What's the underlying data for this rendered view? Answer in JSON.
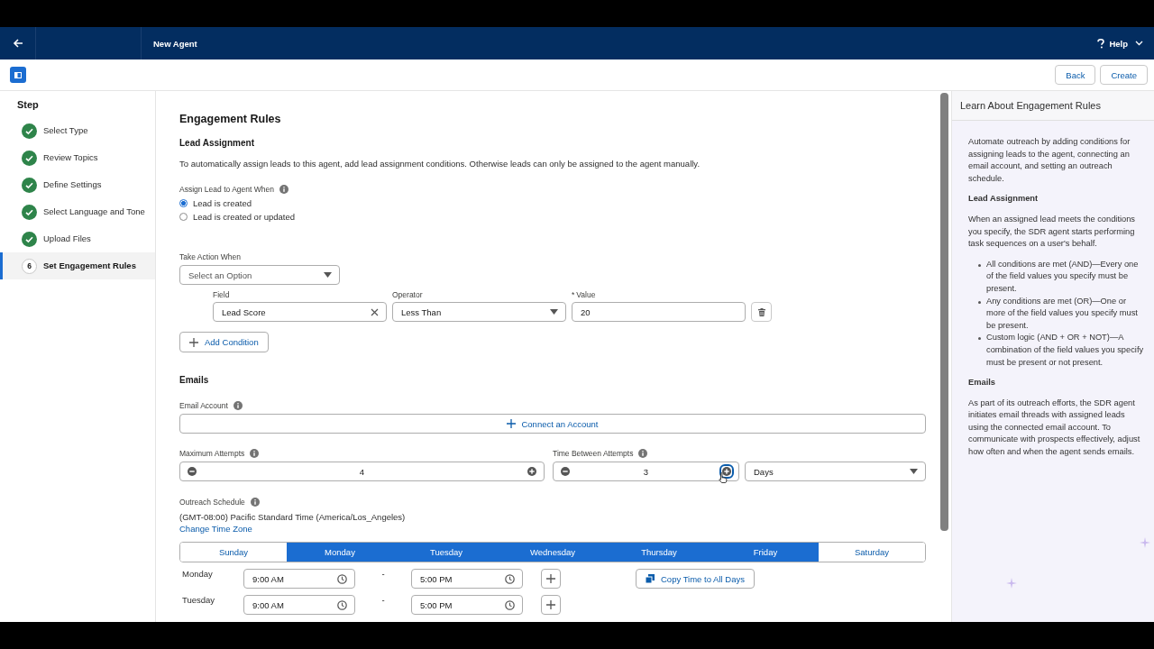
{
  "top_bar": {
    "title": "New Agent",
    "help": "Help"
  },
  "toolbar": {
    "buttons": [
      "Back",
      "Create"
    ]
  },
  "steps": {
    "heading": "Step",
    "items": [
      {
        "label": "Select Type",
        "completed": true,
        "selected": false
      },
      {
        "label": "Review Topics",
        "completed": true,
        "selected": false
      },
      {
        "label": "Define Settings",
        "completed": true,
        "selected": false
      },
      {
        "label": "Select Language and Tone",
        "completed": true,
        "selected": false
      },
      {
        "label": "Upload Files",
        "completed": true,
        "selected": false
      },
      {
        "label": "Set Engagement Rules",
        "completed": false,
        "number": "6",
        "selected": true
      }
    ]
  },
  "main": {
    "title": "Engagement Rules",
    "lead_assignment": {
      "heading": "Lead Assignment",
      "description": "To automatically assign leads to this agent, add lead assignment conditions. Otherwise leads can only be assigned to the agent manually.",
      "assign_label": "Assign Lead to Agent When",
      "options": [
        {
          "label": "Lead is created",
          "selected": true
        },
        {
          "label": "Lead is created or updated",
          "selected": false
        }
      ],
      "take_action": {
        "label": "Take Action When",
        "placeholder": "Select an Option"
      },
      "condition": {
        "field_label": "Field",
        "field_value": "Lead Score",
        "operator_label": "Operator",
        "operator_value": "Less Than",
        "required_mark": "*",
        "value_label": "Value",
        "value": "20"
      },
      "add_condition": "Add Condition"
    },
    "emails": {
      "heading": "Emails",
      "account_label": "Email Account",
      "connect": "Connect an Account",
      "max_attempts": {
        "label": "Maximum Attempts",
        "value": "4"
      },
      "time_between": {
        "label": "Time Between Attempts",
        "value": "3",
        "unit": "Days"
      },
      "schedule_label": "Outreach Schedule",
      "time_zone": "(GMT-08:00) Pacific Standard Time (America/Los_Angeles)",
      "change_time_zone": "Change Time Zone",
      "days": [
        {
          "label": "Sunday",
          "selected": false
        },
        {
          "label": "Monday",
          "selected": true
        },
        {
          "label": "Tuesday",
          "selected": true
        },
        {
          "label": "Wednesday",
          "selected": true
        },
        {
          "label": "Thursday",
          "selected": true
        },
        {
          "label": "Friday",
          "selected": true
        },
        {
          "label": "Saturday",
          "selected": false
        }
      ],
      "schedule": [
        {
          "day": "Monday",
          "start": "9:00 AM",
          "separator": "-",
          "end": "5:00 PM"
        },
        {
          "day": "Tuesday",
          "start": "9:00 AM",
          "separator": "-",
          "end": "5:00 PM"
        }
      ],
      "copy_button": "Copy Time to All Days"
    }
  },
  "help_panel": {
    "title": "Learn About Engagement Rules",
    "content": [
      {
        "kind": "paragraph",
        "text": "Automate outreach by adding conditions for assigning leads to the agent, connecting an email account, and setting an outreach schedule."
      },
      {
        "kind": "heading",
        "text": "Lead Assignment"
      },
      {
        "kind": "paragraph",
        "text": "When an assigned lead meets the conditions you specify, the SDR agent starts performing task sequences on a user's behalf."
      },
      {
        "kind": "bullets",
        "items": [
          "All conditions are met (AND)—Every one of the field values you specify must be present.",
          "Any conditions are met (OR)—One or more of the field values you specify must be present.",
          "Custom logic (AND + OR + NOT)—A combination of the field values you specify must be present or not present."
        ]
      },
      {
        "kind": "heading",
        "text": "Emails"
      },
      {
        "kind": "paragraph",
        "text": "As part of its outreach efforts, the SDR agent initiates email threads with assigned leads using the connected email account. To communicate with prospects effectively, adjust how often and when the agent sends emails."
      }
    ]
  }
}
